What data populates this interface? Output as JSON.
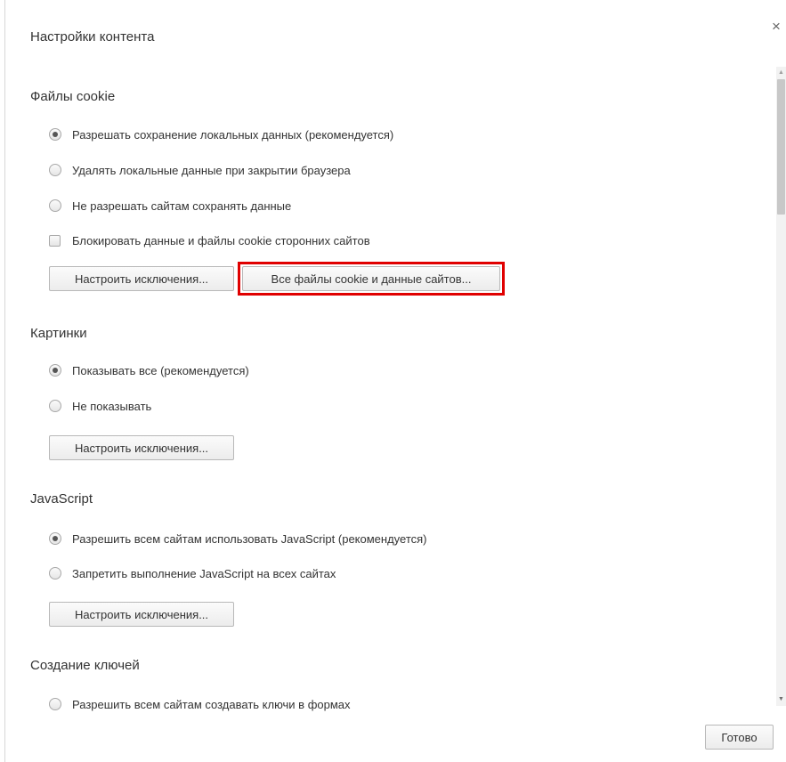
{
  "dialog": {
    "title": "Настройки контента",
    "close": "×",
    "done_label": "Готово"
  },
  "cookies": {
    "heading": "Файлы cookie",
    "options": [
      {
        "label": "Разрешать сохранение локальных данных (рекомендуется)",
        "selected": true
      },
      {
        "label": "Удалять локальные данные при закрытии браузера",
        "selected": false
      },
      {
        "label": "Не разрешать сайтам сохранять данные",
        "selected": false
      }
    ],
    "block_third_party": {
      "label": "Блокировать данные и файлы cookie сторонних сайтов",
      "checked": false
    },
    "exceptions_button": "Настроить исключения...",
    "all_cookies_button": "Все файлы cookie и данные сайтов..."
  },
  "images": {
    "heading": "Картинки",
    "options": [
      {
        "label": "Показывать все (рекомендуется)",
        "selected": true
      },
      {
        "label": "Не показывать",
        "selected": false
      }
    ],
    "exceptions_button": "Настроить исключения..."
  },
  "javascript": {
    "heading": "JavaScript",
    "options": [
      {
        "label": "Разрешить всем сайтам использовать JavaScript (рекомендуется)",
        "selected": true
      },
      {
        "label": "Запретить выполнение JavaScript на всех сайтах",
        "selected": false
      }
    ],
    "exceptions_button": "Настроить исключения..."
  },
  "keygen": {
    "heading": "Создание ключей",
    "options": [
      {
        "label": "Разрешить всем сайтам создавать ключи в формах",
        "selected": false
      }
    ]
  },
  "colors": {
    "highlight": "#e00000"
  }
}
